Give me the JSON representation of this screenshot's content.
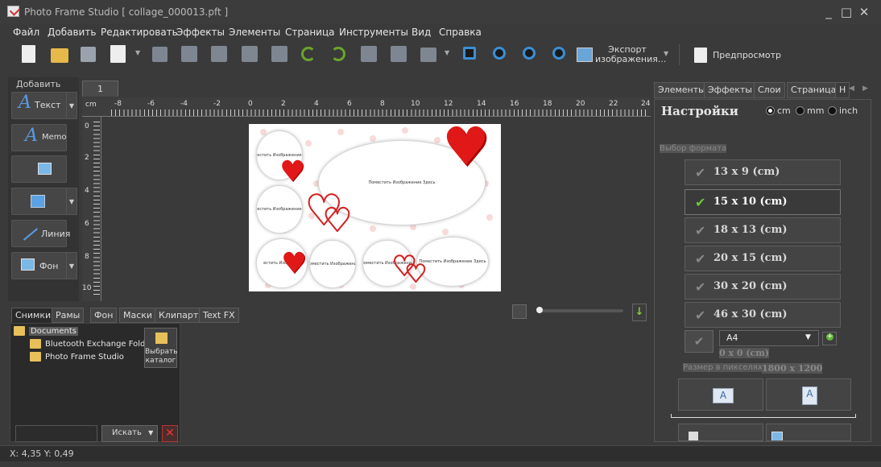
{
  "window": {
    "title": "Photo Frame Studio [ collage_000013.pft ]",
    "controls": [
      "_",
      "□",
      "✕"
    ]
  },
  "menu": [
    "Файл",
    "Добавить",
    "Редактировать",
    "Эффекты",
    "Элементы",
    "Страница",
    "Инструменты",
    "Вид",
    "Справка"
  ],
  "toolbar": {
    "export_label": "Экспорт изображения...",
    "preview_label": "Предпросмотр"
  },
  "left_panel": {
    "header": "Добавить",
    "buttons": {
      "text": "Текст",
      "memo": "Memo",
      "line": "Линия",
      "background": "Фон"
    }
  },
  "page_tab": "1",
  "ruler": {
    "unit": "cm",
    "h_labels": [
      "-8",
      "-6",
      "-4",
      "-2",
      "0",
      "2",
      "4",
      "6",
      "8",
      "10",
      "12",
      "14",
      "16",
      "18",
      "20",
      "22",
      "24"
    ],
    "v_labels": [
      "0",
      "2",
      "4",
      "6",
      "8",
      "10"
    ]
  },
  "collage": {
    "placeholder_text": "Поместить Изображение Здесь",
    "small_text_1": "естить Изображение",
    "small_text_2": "естить Изображение",
    "small_text_3": "естить Изображе",
    "small_text_4": "Поместить Изображение",
    "small_text_5": "Поместить Изображение",
    "small_text_6": "Поместить Изображение Здесь"
  },
  "bottom_tabs": [
    "Снимки",
    "Рамы",
    "Фон",
    "Маски",
    "Клипарт",
    "Text FX"
  ],
  "browser": {
    "root": "Documents",
    "folders": [
      "Bluetooth Exchange Folder",
      "Photo Frame Studio"
    ],
    "choose_folder": "Выбрать каталог",
    "search_button": "Искать"
  },
  "right_tabs": [
    "Элементы",
    "Эффекты",
    "Слои",
    "Страница",
    "Н"
  ],
  "settings": {
    "title": "Настройки",
    "units": [
      "cm",
      "mm",
      "inch"
    ],
    "selected_unit": "cm",
    "format_hint": "Выбор формата",
    "formats": [
      "13 x 9 (cm)",
      "15 x 10 (cm)",
      "18 x 13 (cm)",
      "20 x 15 (cm)",
      "30 x 20 (cm)",
      "46 x 30 (cm)"
    ],
    "selected_format": "15 x 10 (cm)",
    "custom_format": "A4",
    "custom_size": "0 x 0 (cm)",
    "pixel_size_label": "Размер в пикселях",
    "pixel_size_value": "1800 x 1200"
  },
  "status": "X: 4,35 Y: 0,49",
  "colors": {
    "accent_green": "#6cc53a",
    "heart_red": "#e01818",
    "background": "#3a3a3a"
  }
}
